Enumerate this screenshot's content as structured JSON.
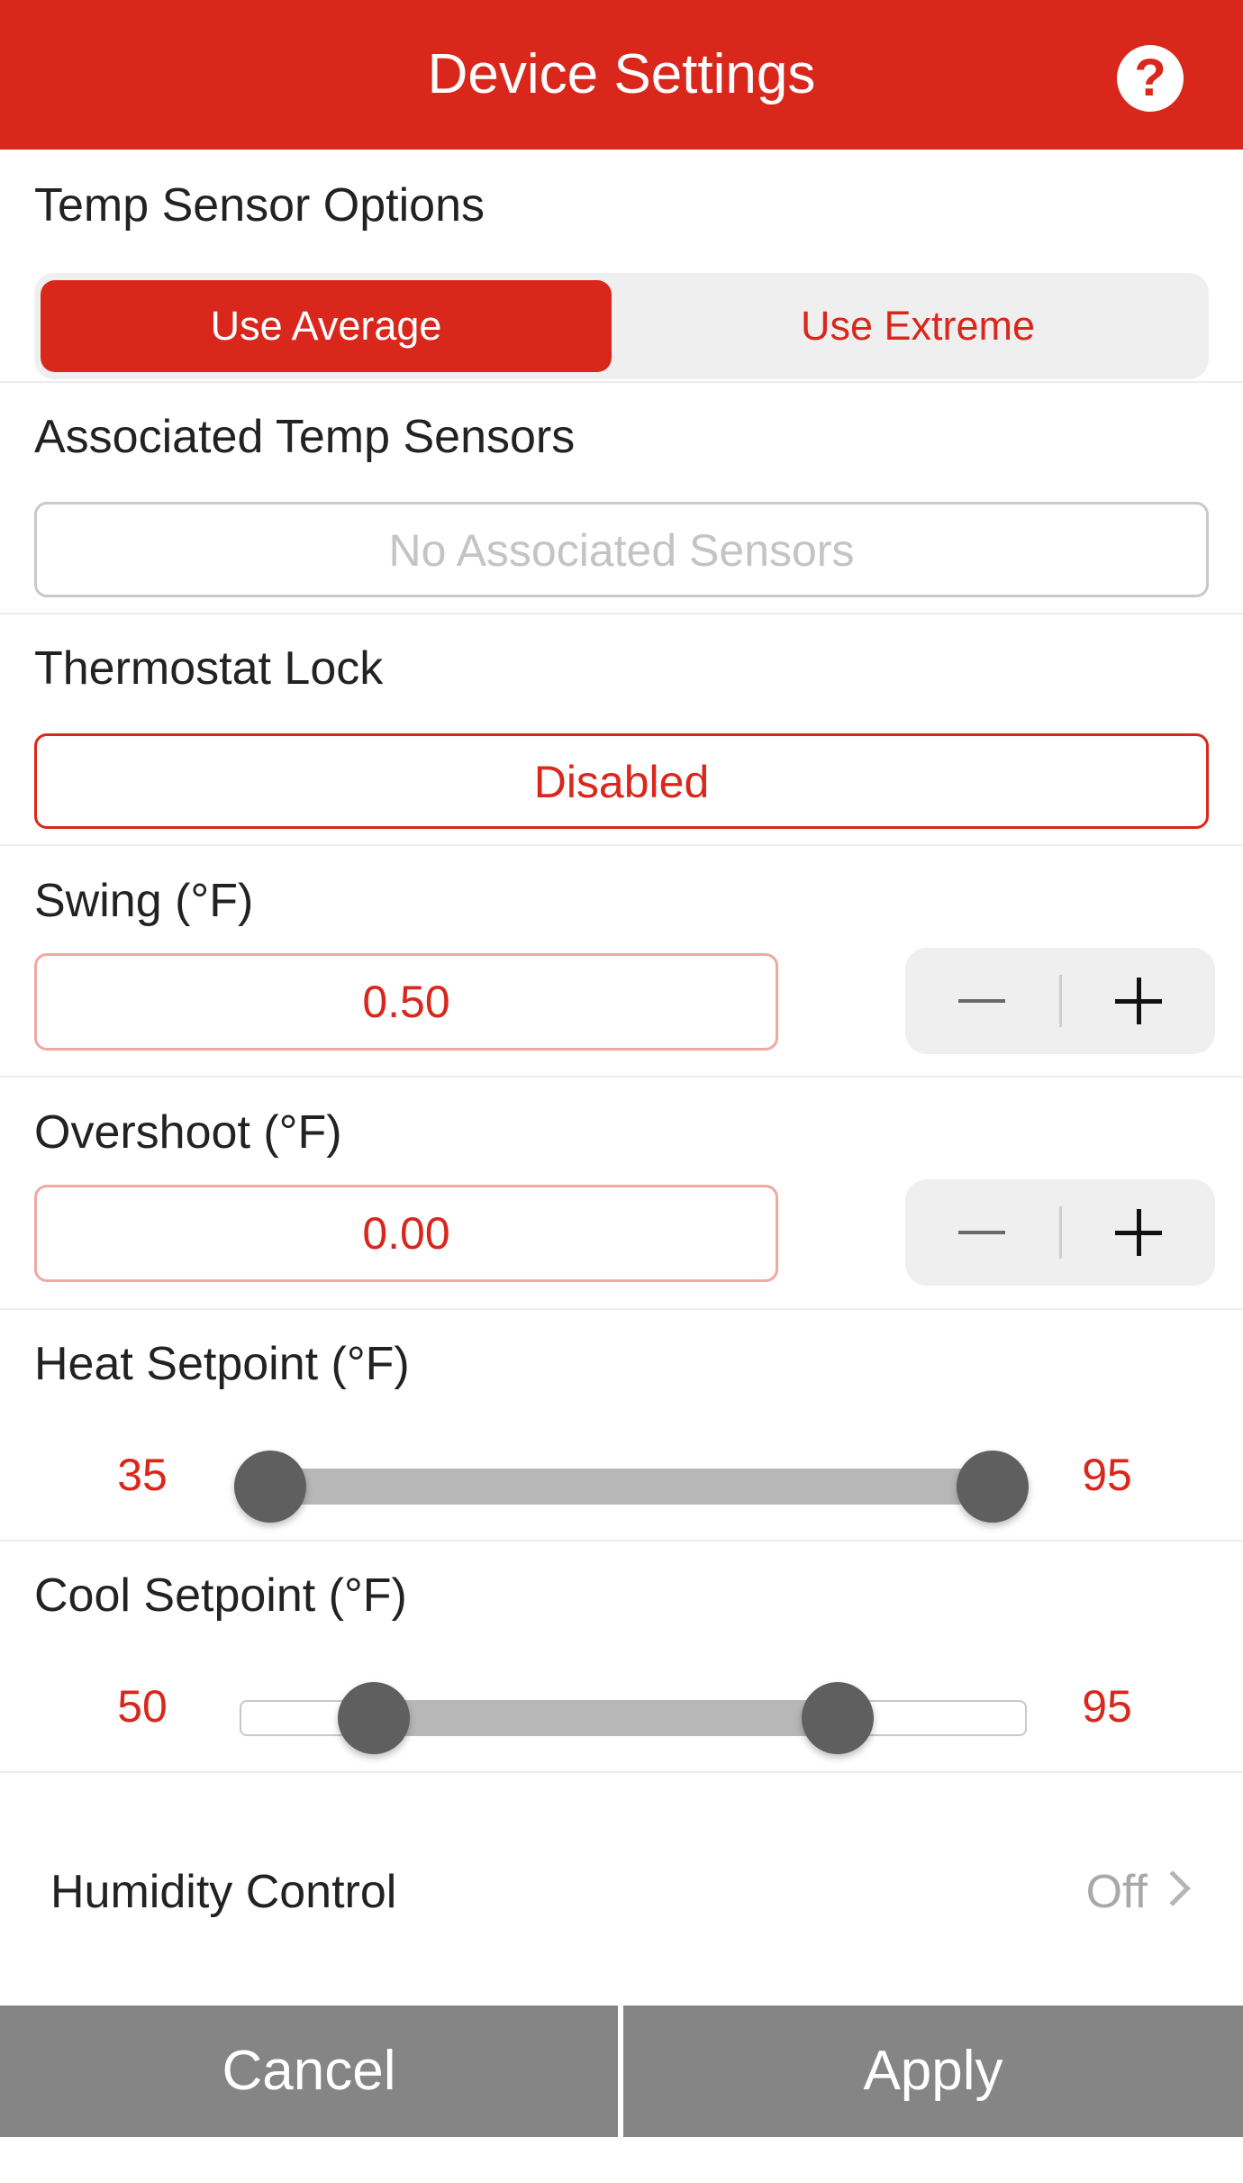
{
  "header": {
    "title": "Device Settings",
    "help_icon": "?"
  },
  "temp_sensor_options": {
    "label": "Temp Sensor Options",
    "options": [
      "Use Average",
      "Use Extreme"
    ],
    "selected": "Use Average"
  },
  "associated_sensors": {
    "label": "Associated Temp Sensors",
    "placeholder": "No Associated Sensors"
  },
  "thermostat_lock": {
    "label": "Thermostat Lock",
    "value": "Disabled"
  },
  "swing": {
    "label": "Swing (°F)",
    "value": "0.50"
  },
  "overshoot": {
    "label": "Overshoot (°F)",
    "value": "0.00"
  },
  "heat_setpoint": {
    "label": "Heat Setpoint (°F)",
    "min_label": "35",
    "max_label": "95",
    "low": 35,
    "high": 95
  },
  "cool_setpoint": {
    "label": "Cool Setpoint (°F)",
    "min_label": "50",
    "max_label": "95",
    "low": 50,
    "high": 95,
    "low_fraction": 0.17,
    "high_fraction": 0.76
  },
  "humidity_control": {
    "label": "Humidity Control",
    "value": "Off"
  },
  "footer": {
    "cancel": "Cancel",
    "apply": "Apply"
  },
  "colors": {
    "accent": "#d9271c",
    "footer_button": "#858585",
    "segment_bg": "#efefef"
  }
}
